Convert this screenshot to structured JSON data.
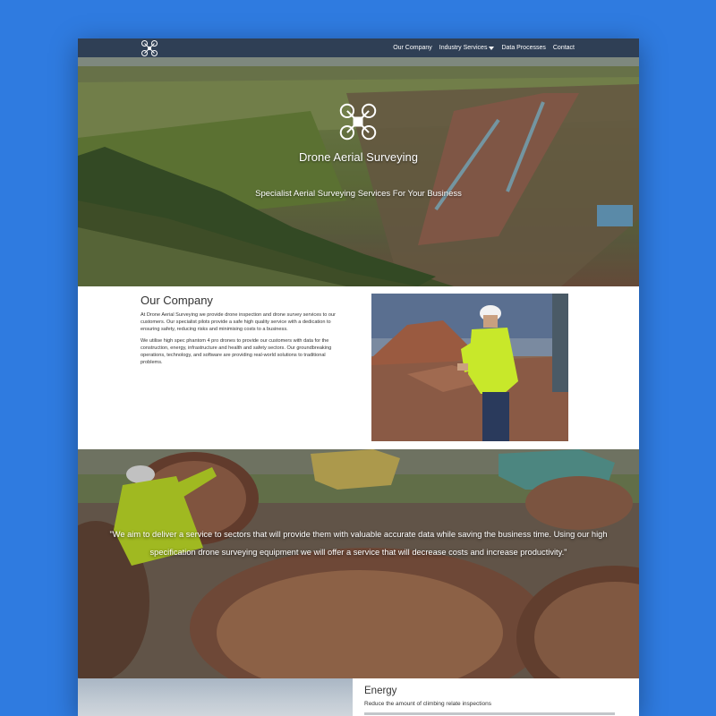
{
  "nav": {
    "logo_icon": "drone-icon",
    "items": [
      {
        "label": "Our Company"
      },
      {
        "label": "Industry Services"
      },
      {
        "label": "Data Processes"
      },
      {
        "label": "Contact"
      }
    ]
  },
  "hero": {
    "title": "Drone Aerial Surveying",
    "subtitle": "Specialist Aerial Surveying Services For Your Business"
  },
  "company": {
    "heading": "Our Company",
    "paragraph1": "At Drone Aerial Surveying we provide drone inspection and drone survey services to our customers. Our specialist pilots provide a safe high quality service with a dedication to ensuring safety, reducing risks and minimising costs to a business.",
    "paragraph2": "We utilise high spec phantom 4 pro drones to provide our customers with data for the construction, energy, infrastructure and health and safety sectors. Our groundbreaking operations, technology, and software are providing real-world solutions to traditional problems."
  },
  "quote": {
    "text": "\"We aim to deliver a service to sectors that will provide them with valuable accurate data while saving the business time. Using our high specification drone surveying equipment we will offer a service that will decrease costs and increase productivity.\""
  },
  "energy": {
    "heading": "Energy",
    "subheading": "Reduce the amount of climbing relate inspections"
  },
  "colors": {
    "background": "#2f7be0",
    "nav": "#2f3f55",
    "hi_vis": "#c8e82a"
  }
}
